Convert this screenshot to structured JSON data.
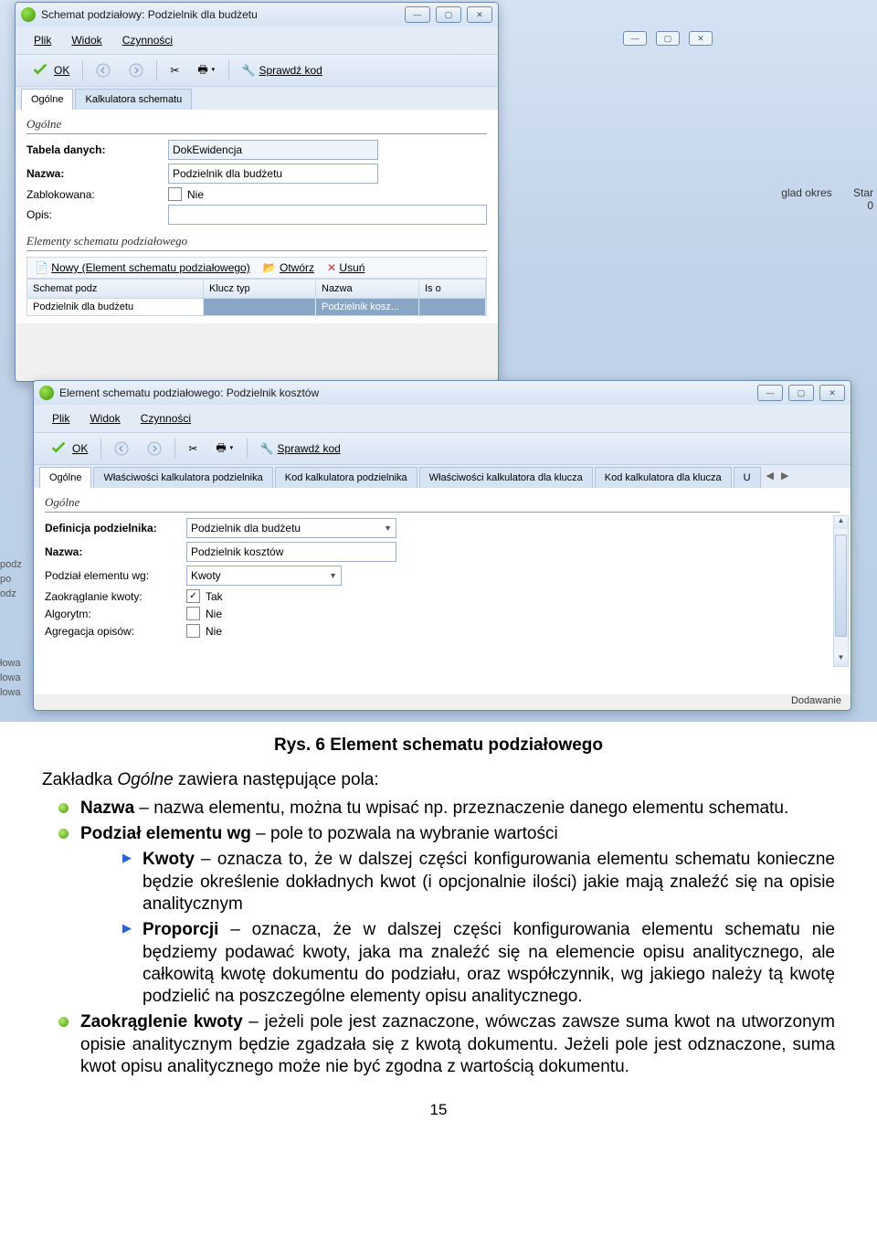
{
  "win1": {
    "title": "Schemat podziałowy: Podzielnik dla budżetu",
    "menu": [
      "Plik",
      "Widok",
      "Czynności"
    ],
    "toolbar": {
      "ok": "OK",
      "sprawdz": "Sprawdź kod"
    },
    "tabs": [
      "Ogólne",
      "Kalkulatora schematu"
    ],
    "group1": "Ogólne",
    "labels": {
      "tabela": "Tabela danych:",
      "nazwa": "Nazwa:",
      "zablokowana": "Zablokowana:",
      "opis": "Opis:"
    },
    "vals": {
      "tabela": "DokEwidencja",
      "nazwa": "Podzielnik dla budżetu",
      "zablokowana": "Nie"
    },
    "group2": "Elementy schematu podziałowego",
    "gridbar": {
      "nowy": "Nowy (Element schematu podziałowego)",
      "otworz": "Otwórz",
      "usun": "Usuń"
    },
    "gridcols": [
      "Schemat podz",
      "Klucz typ",
      "Nazwa",
      "Is o"
    ],
    "gridrow": [
      "Podzielnik dla budżetu",
      "",
      "Podzielnik kosz...",
      ""
    ]
  },
  "win2": {
    "title": "Element schematu podziałowego: Podzielnik kosztów",
    "menu": [
      "Plik",
      "Widok",
      "Czynności"
    ],
    "toolbar": {
      "ok": "OK",
      "sprawdz": "Sprawdź kod"
    },
    "tabs": [
      "Ogólne",
      "Właściwości kalkulatora podzielnika",
      "Kod kalkulatora podzielnika",
      "Właściwości kalkulatora dla klucza",
      "Kod kalkulatora dla klucza",
      "U"
    ],
    "group1": "Ogólne",
    "labels": {
      "definicja": "Definicja podzielnika:",
      "nazwa": "Nazwa:",
      "podzial": "Podział elementu wg:",
      "zaokraglanie": "Zaokrąglanie kwoty:",
      "algorytm": "Algorytm:",
      "agregacja": "Agregacja opisów:"
    },
    "vals": {
      "definicja": "Podzielnik dla budżetu",
      "nazwa": "Podzielnik kosztów",
      "podzial": "Kwoty",
      "zaokraglanie": "Tak",
      "algorytm": "Nie",
      "agregacja": "Nie"
    },
    "status": "Dodawanie"
  },
  "bg": {
    "col1": "glad okres",
    "col2": "Star",
    "zero": "0",
    "partial_left": [
      "podz",
      "po",
      "odz",
      "",
      "łowa",
      "lowa",
      "lowa"
    ]
  },
  "doc": {
    "fig": "Rys. 6 Element schematu podziałowego",
    "intro_pre": "Zakładka ",
    "intro_it": "Ogólne",
    "intro_post": " zawiera następujące pola:",
    "b1_bold": "Nazwa",
    "b1_rest": " – nazwa elementu, można tu wpisać np. przeznaczenie danego elementu schematu.",
    "b2_bold": "Podział elementu wg",
    "b2_rest": " – pole to pozwala na wybranie wartości",
    "a1_bold": "Kwoty",
    "a1_rest": " – oznacza to, że w dalszej części konfigurowania elementu schematu konieczne będzie określenie dokładnych kwot (i opcjonalnie ilości) jakie mają znaleźć się na opisie analitycznym",
    "a2_bold": "Proporcji",
    "a2_rest": " – oznacza, że w dalszej części konfigurowania elementu schematu nie będziemy podawać kwoty, jaka ma znaleźć się na elemencie opisu analitycznego, ale całkowitą kwotę dokumentu do podziału, oraz współczynnik, wg jakiego należy tą kwotę podzielić na poszczególne elementy opisu analitycznego.",
    "b3_bold": "Zaokrąglenie kwoty",
    "b3_rest": " – jeżeli pole jest zaznaczone, wówczas zawsze suma kwot na utworzonym opisie analitycznym będzie zgadzała się z kwotą dokumentu. Jeżeli pole jest odznaczone, suma kwot opisu analitycznego może nie być zgodna z wartością dokumentu.",
    "page": "15"
  }
}
